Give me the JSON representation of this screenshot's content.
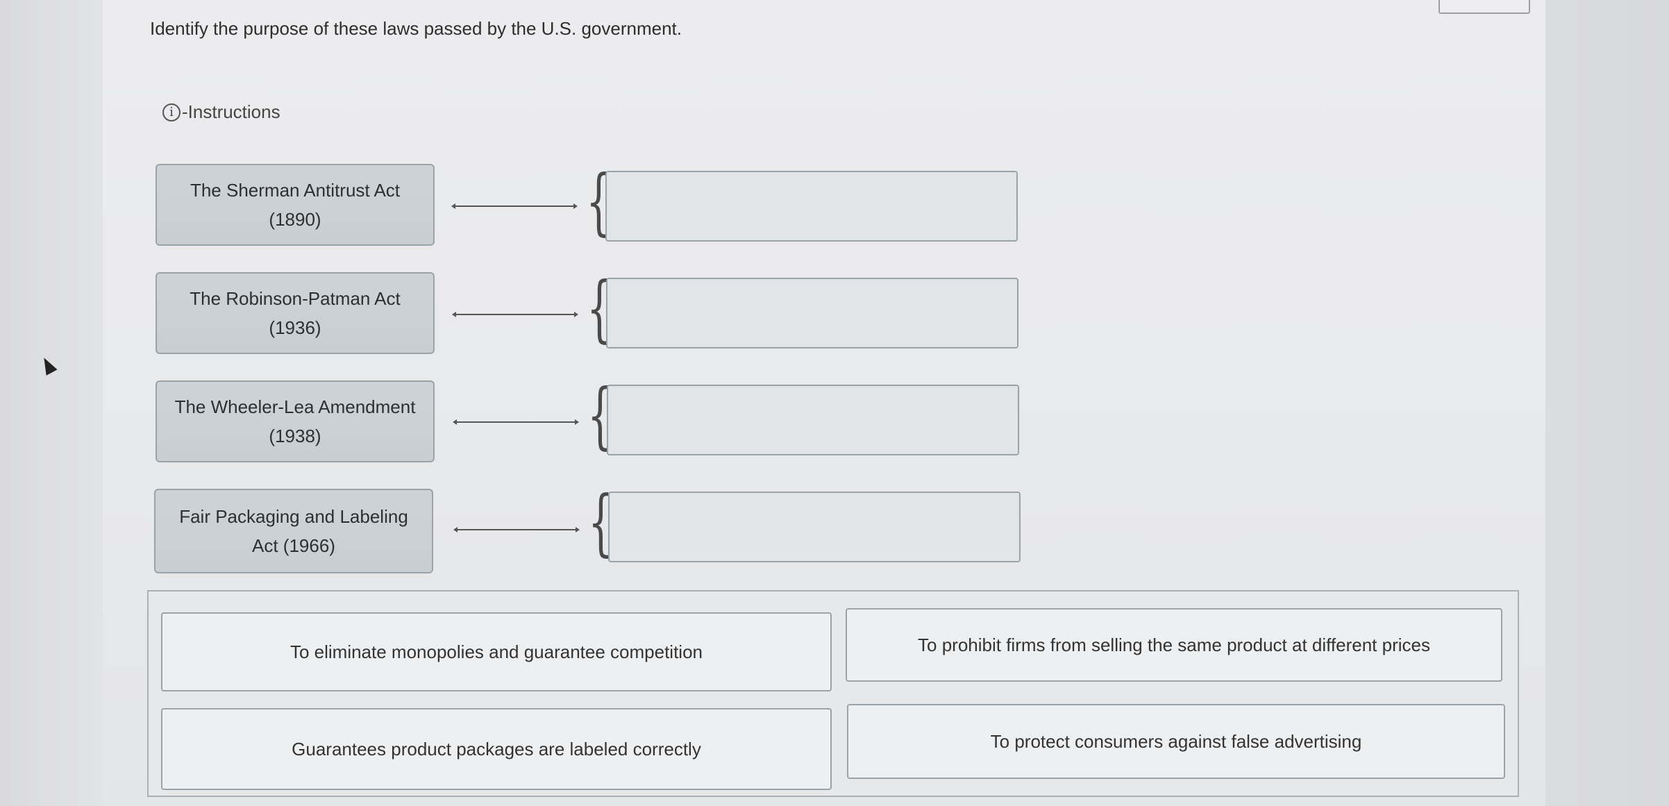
{
  "question": {
    "prompt": "Identify the purpose of these laws passed by the U.S. government.",
    "instructions_label": "-Instructions",
    "info_icon": "i"
  },
  "laws": [
    {
      "name": "The Sherman Antitrust Act (1890)"
    },
    {
      "name": "The Robinson-Patman Act (1936)"
    },
    {
      "name": "The Wheeler-Lea Amendment (1938)"
    },
    {
      "name": "Fair Packaging and Labeling Act (1966)"
    }
  ],
  "connector_icon": "double-arrow-icon",
  "brace_icon": "curly-brace-icon",
  "answers": [
    {
      "text": "To eliminate monopolies and guarantee competition"
    },
    {
      "text": "To prohibit firms from selling the same product at different prices"
    },
    {
      "text": "Guarantees product packages are labeled correctly"
    },
    {
      "text": "To protect consumers against false advertising"
    }
  ],
  "colors": {
    "law_card_bg": "#c8ced2",
    "drop_box_bg": "#e1e5e8",
    "page_bg": "#e8e9eb"
  }
}
